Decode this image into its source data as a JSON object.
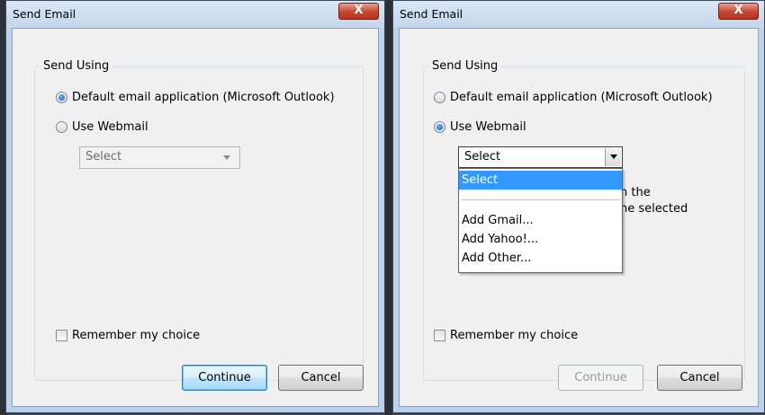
{
  "left_dialog": {
    "title": "Send Email",
    "close_label": "X",
    "group_label": "Send Using",
    "radio_default_label": "Default email application (Microsoft Outlook)",
    "radio_webmail_label": "Use Webmail",
    "select_value": "Select",
    "remember_label": "Remember my choice",
    "continue_label": "Continue",
    "cancel_label": "Cancel"
  },
  "right_dialog": {
    "title": "Send Email",
    "close_label": "X",
    "group_label": "Send Using",
    "radio_default_label": "Default email application (Microsoft Outlook)",
    "radio_webmail_label": "Use Webmail",
    "select_value": "Select",
    "dropdown_options": [
      "Select",
      "Add Gmail...",
      "Add Yahoo!...",
      "Add Other..."
    ],
    "partial_text_line1": "n the",
    "partial_text_line2": "he selected",
    "remember_label": "Remember my choice",
    "continue_label": "Continue",
    "cancel_label": "Cancel"
  },
  "colors": {
    "window_frame": "#bcd2ea",
    "close_button": "#c8452e",
    "selection_highlight": "#3399ff"
  }
}
